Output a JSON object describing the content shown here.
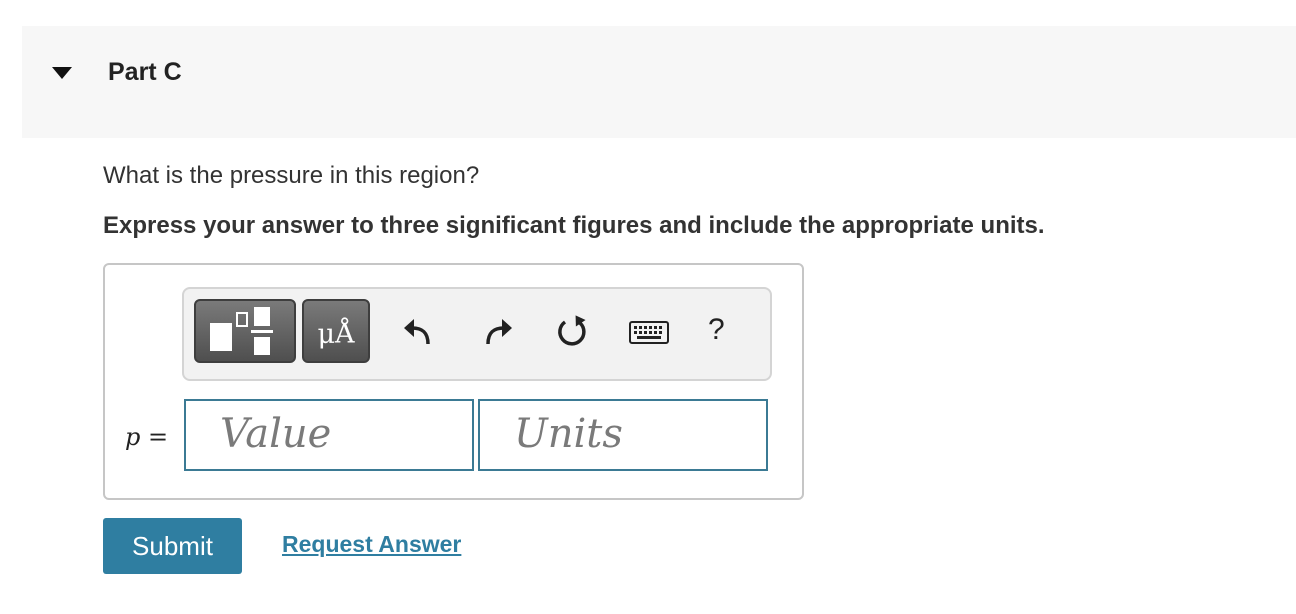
{
  "part": {
    "title": "Part C"
  },
  "question": {
    "text": "What is the pressure in this region?",
    "instruction": "Express your answer to three significant figures and include the appropriate units."
  },
  "toolbar": {
    "units_label": "μÅ",
    "help_label": "?",
    "icons": [
      "templates-icon",
      "units-icon",
      "undo-icon",
      "redo-icon",
      "reset-icon",
      "keyboard-icon",
      "help-icon"
    ]
  },
  "answer": {
    "variable": "p",
    "equals": "=",
    "value_placeholder": "Value",
    "units_placeholder": "Units"
  },
  "actions": {
    "submit_label": "Submit",
    "request_label": "Request Answer"
  },
  "colors": {
    "accent": "#2f7ea1",
    "field_border": "#3b7a94",
    "header_bg": "#f7f7f7"
  }
}
